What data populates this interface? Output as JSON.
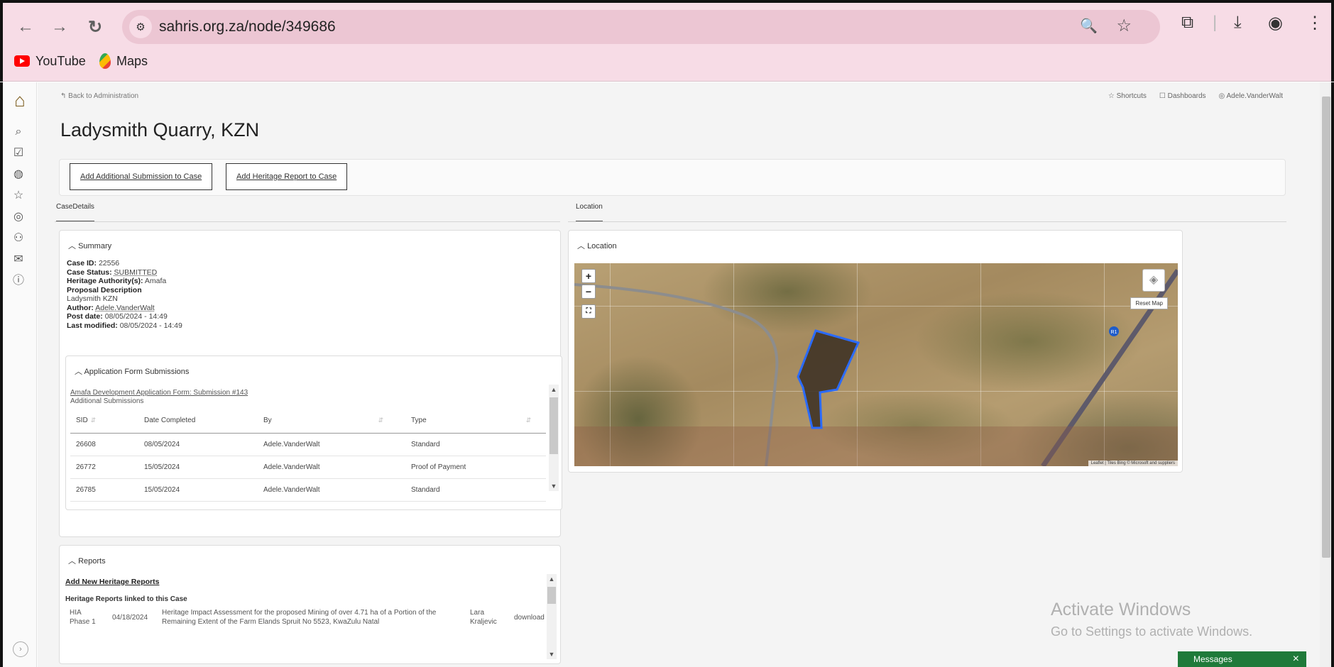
{
  "browser": {
    "back_icon": "arrow-left-icon",
    "forward_icon": "arrow-right-icon",
    "reload_icon": "reload-icon",
    "url": "sahris.org.za/node/349686",
    "bookmarks": [
      {
        "label": "YouTube",
        "icon": "youtube-icon"
      },
      {
        "label": "Maps",
        "icon": "maps-icon"
      }
    ]
  },
  "page": {
    "back_link": "Back to Administration",
    "top_links": {
      "shortcuts": "Shortcuts",
      "dashboards": "Dashboards",
      "user": "Adele.VanderWalt"
    },
    "title": "Ladysmith Quarry, KZN",
    "actions": {
      "add_submission": "Add Additional Submission to Case",
      "add_report": "Add Heritage Report to Case"
    },
    "tabs": {
      "case_details": "CaseDetails",
      "location": "Location"
    }
  },
  "summary": {
    "title": "Summary",
    "case_id_label": "Case ID:",
    "case_id": "22556",
    "case_status_label": "Case Status:",
    "case_status": "SUBMITTED",
    "authority_label": "Heritage Authority(s):",
    "authority": "Amafa",
    "proposal_label": "Proposal Description",
    "proposal": "Ladysmith KZN",
    "author_label": "Author:",
    "author": "Adele.VanderWalt",
    "post_date_label": "Post date:",
    "post_date": "08/05/2024 - 14:49",
    "last_modified_label": "Last modified:",
    "last_modified": "08/05/2024 - 14:49"
  },
  "submissions": {
    "title": "Application Form Submissions",
    "form_link": "Amafa Development Application Form: Submission #143",
    "additional": "Additional Submissions",
    "columns": [
      "SID",
      "Date Completed",
      "By",
      "Type"
    ],
    "rows": [
      {
        "sid": "26608",
        "date": "08/05/2024",
        "by": "Adele.VanderWalt",
        "type": "Standard"
      },
      {
        "sid": "26772",
        "date": "15/05/2024",
        "by": "Adele.VanderWalt",
        "type": "Proof of Payment"
      },
      {
        "sid": "26785",
        "date": "15/05/2024",
        "by": "Adele.VanderWalt",
        "type": "Standard"
      }
    ]
  },
  "reports": {
    "title": "Reports",
    "add_link": "Add New Heritage Reports",
    "linked_title": "Heritage Reports linked to this Case",
    "row": {
      "type_line1": "HIA",
      "type_line2": "Phase 1",
      "date": "04/18/2024",
      "desc_line1": "Heritage Impact Assessment for the proposed Mining of over 4.71 ha of a Portion of the",
      "desc_line2": "Remaining Extent of the Farm Elands Spruit No 5523, KwaZulu Natal",
      "author_line1": "Lara",
      "author_line2": "Kraljevic",
      "action": "download"
    }
  },
  "location": {
    "title": "Location",
    "zoom_in": "+",
    "zoom_out": "−",
    "reset": "Reset Map",
    "attribution": "Leaflet | Tiles Bing © Microsoft and suppliers",
    "road_marker": "R1"
  },
  "overlay": {
    "watermark_title": "Activate Windows",
    "watermark_sub": "Go to Settings to activate Windows.",
    "messages": "Messages",
    "messages_close": "×"
  }
}
